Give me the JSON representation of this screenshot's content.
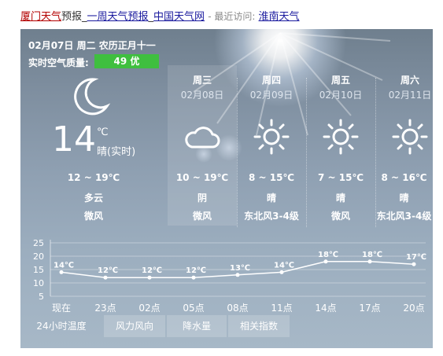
{
  "header": {
    "city_weather_link": "厦门天气",
    "forecast_suffix": "预报",
    "week_link": "一周天气预报",
    "sep": "_",
    "china_link": "中国天气网",
    "recent_label": "- 最近访问:",
    "recent_city": "淮南天气"
  },
  "today": {
    "date": "02月07日 周二 农历正月十一",
    "aqi_label": "实时空气质量:",
    "aqi_value": "49 优",
    "aqi_color": "#3fbf3f",
    "icon": "moon-icon",
    "temp": "14",
    "unit": "℃",
    "condition": "晴(实时)",
    "range": "12 ~ 19℃",
    "weather": "多云",
    "wind": "微风"
  },
  "forecast": [
    {
      "day": "周三",
      "date": "02月08日",
      "icon": "cloud-icon",
      "range": "10 ~ 19℃",
      "weather": "阴",
      "wind": "微风"
    },
    {
      "day": "周四",
      "date": "02月09日",
      "icon": "sun-icon",
      "range": "8 ~ 15℃",
      "weather": "晴",
      "wind": "东北风3-4级"
    },
    {
      "day": "周五",
      "date": "02月10日",
      "icon": "sun-icon",
      "range": "7 ~ 15℃",
      "weather": "晴",
      "wind": "微风"
    },
    {
      "day": "周六",
      "date": "02月11日",
      "icon": "sun-icon",
      "range": "8 ~ 16℃",
      "weather": "晴",
      "wind": "东北风3-4级"
    }
  ],
  "chart_data": {
    "type": "line",
    "title": "",
    "xlabel": "",
    "ylabel": "",
    "categories": [
      "现在",
      "23点",
      "02点",
      "05点",
      "08点",
      "11点",
      "14点",
      "17点",
      "20点"
    ],
    "series": [
      {
        "values": [
          14,
          12,
          12,
          12,
          13,
          14,
          18,
          18,
          17
        ],
        "labels": [
          "14℃",
          "12℃",
          "12℃",
          "12℃",
          "13℃",
          "14℃",
          "18℃",
          "18℃",
          "17℃"
        ]
      }
    ],
    "yticks": [
      5,
      10,
      15,
      20,
      25
    ],
    "ylim": [
      5,
      25
    ],
    "grid": true
  },
  "tabs": [
    "24小时温度",
    "风力风向",
    "降水量",
    "相关指数"
  ]
}
